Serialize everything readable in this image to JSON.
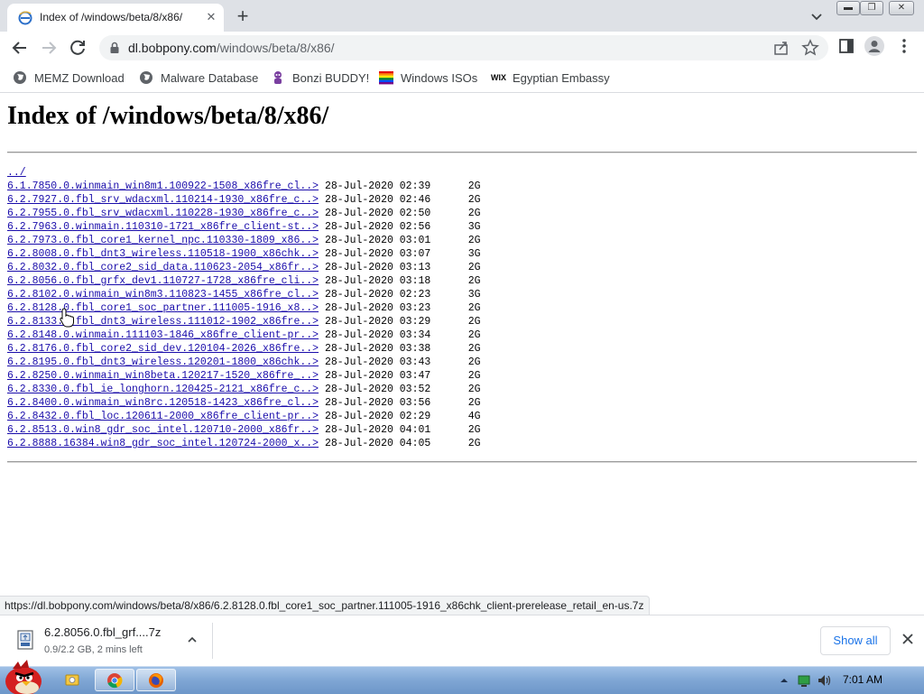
{
  "browser": {
    "tab_title": "Index of /windows/beta/8/x86/",
    "url_host": "dl.bobpony.com",
    "url_path": "/windows/beta/8/x86/"
  },
  "bookmarks": [
    {
      "label": "MEMZ Download",
      "icon": "globe-icon"
    },
    {
      "label": "Malware Database",
      "icon": "globe-icon"
    },
    {
      "label": "Bonzi BUDDY!",
      "icon": "bonzi-icon"
    },
    {
      "label": "Windows ISOs",
      "icon": "rainbow-flag-icon"
    },
    {
      "label": "Egyptian Embassy",
      "icon": "wix-icon"
    }
  ],
  "page": {
    "heading": "Index of /windows/beta/8/x86/",
    "parent_link": "../",
    "files": [
      {
        "name": "6.1.7850.0.winmain_win8m1.100922-1508_x86fre_cl..>",
        "date": "28-Jul-2020 02:39",
        "size": "2G"
      },
      {
        "name": "6.2.7927.0.fbl_srv_wdacxml.110214-1930_x86fre_c..>",
        "date": "28-Jul-2020 02:46",
        "size": "2G"
      },
      {
        "name": "6.2.7955.0.fbl_srv_wdacxml.110228-1930_x86fre_c..>",
        "date": "28-Jul-2020 02:50",
        "size": "2G"
      },
      {
        "name": "6.2.7963.0.winmain.110310-1721_x86fre_client-st..>",
        "date": "28-Jul-2020 02:56",
        "size": "3G"
      },
      {
        "name": "6.2.7973.0.fbl_core1_kernel_npc.110330-1809_x86..>",
        "date": "28-Jul-2020 03:01",
        "size": "2G"
      },
      {
        "name": "6.2.8008.0.fbl_dnt3_wireless.110518-1900_x86chk..>",
        "date": "28-Jul-2020 03:07",
        "size": "3G"
      },
      {
        "name": "6.2.8032.0.fbl_core2_sid_data.110623-2054_x86fr..>",
        "date": "28-Jul-2020 03:13",
        "size": "2G"
      },
      {
        "name": "6.2.8056.0.fbl_grfx_dev1.110727-1728_x86fre_cli..>",
        "date": "28-Jul-2020 03:18",
        "size": "2G"
      },
      {
        "name": "6.2.8102.0.winmain_win8m3.110823-1455_x86fre_cl..>",
        "date": "28-Jul-2020 02:23",
        "size": "3G"
      },
      {
        "name": "6.2.8128.0.fbl_core1_soc_partner.111005-1916_x8..>",
        "date": "28-Jul-2020 03:23",
        "size": "2G"
      },
      {
        "name": "6.2.8133.0.fbl_dnt3_wireless.111012-1902_x86fre..>",
        "date": "28-Jul-2020 03:29",
        "size": "2G"
      },
      {
        "name": "6.2.8148.0.winmain.111103-1846_x86fre_client-pr..>",
        "date": "28-Jul-2020 03:34",
        "size": "2G"
      },
      {
        "name": "6.2.8176.0.fbl_core2_sid_dev.120104-2026_x86fre..>",
        "date": "28-Jul-2020 03:38",
        "size": "2G"
      },
      {
        "name": "6.2.8195.0.fbl_dnt3_wireless.120201-1800_x86chk..>",
        "date": "28-Jul-2020 03:43",
        "size": "2G"
      },
      {
        "name": "6.2.8250.0.winmain_win8beta.120217-1520_x86fre_..>",
        "date": "28-Jul-2020 03:47",
        "size": "2G"
      },
      {
        "name": "6.2.8330.0.fbl_ie_longhorn.120425-2121_x86fre_c..>",
        "date": "28-Jul-2020 03:52",
        "size": "2G"
      },
      {
        "name": "6.2.8400.0.winmain_win8rc.120518-1423_x86fre_cl..>",
        "date": "28-Jul-2020 03:56",
        "size": "2G"
      },
      {
        "name": "6.2.8432.0.fbl_loc.120611-2000_x86fre_client-pr..>",
        "date": "28-Jul-2020 02:29",
        "size": "4G"
      },
      {
        "name": "6.2.8513.0.win8_gdr_soc_intel.120710-2000_x86fr..>",
        "date": "28-Jul-2020 04:01",
        "size": "2G"
      },
      {
        "name": "6.2.8888.16384.win8_gdr_soc_intel.120724-2000_x..>",
        "date": "28-Jul-2020 04:05",
        "size": "2G"
      }
    ]
  },
  "status_url": "https://dl.bobpony.com/windows/beta/8/x86/6.2.8128.0.fbl_core1_soc_partner.111005-1916_x86chk_client-prerelease_retail_en-us.7z",
  "download": {
    "filename": "6.2.8056.0.fbl_grf....7z",
    "status": "0.9/2.2 GB, 2 mins left",
    "show_all_label": "Show all"
  },
  "taskbar": {
    "clock": "7:01 AM",
    "apps": [
      "angry-bird-start-icon",
      "explorer-icon",
      "chrome-icon",
      "firefox-icon"
    ]
  },
  "colors": {
    "link": "#1a0dab",
    "accent": "#1a73e8",
    "tabstrip": "#dee1e6"
  }
}
